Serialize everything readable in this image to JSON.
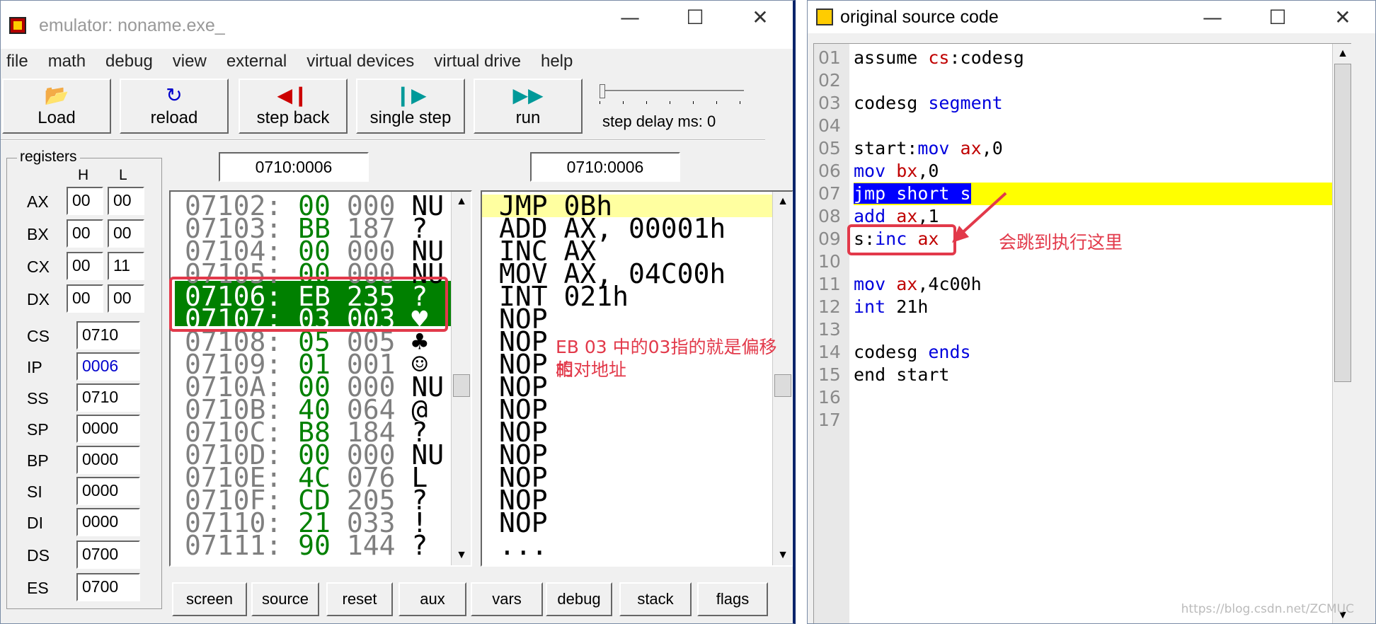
{
  "emulator": {
    "title": "emulator: noname.exe_",
    "menu": [
      "file",
      "math",
      "debug",
      "view",
      "external",
      "virtual devices",
      "virtual drive",
      "help"
    ],
    "toolbar": {
      "load": "Load",
      "reload": "reload",
      "step_back": "step back",
      "single_step": "single step",
      "run": "run",
      "step_delay": "step delay ms: 0"
    },
    "registers": {
      "legend": "registers",
      "h": "H",
      "l": "L",
      "ax": {
        "name": "AX",
        "h": "00",
        "l": "00"
      },
      "bx": {
        "name": "BX",
        "h": "00",
        "l": "00"
      },
      "cx": {
        "name": "CX",
        "h": "00",
        "l": "11"
      },
      "dx": {
        "name": "DX",
        "h": "00",
        "l": "00"
      },
      "cs": {
        "name": "CS",
        "v": "0710"
      },
      "ip": {
        "name": "IP",
        "v": "0006"
      },
      "ss": {
        "name": "SS",
        "v": "0710"
      },
      "sp": {
        "name": "SP",
        "v": "0000"
      },
      "bp": {
        "name": "BP",
        "v": "0000"
      },
      "si": {
        "name": "SI",
        "v": "0000"
      },
      "di": {
        "name": "DI",
        "v": "0000"
      },
      "ds": {
        "name": "DS",
        "v": "0700"
      },
      "es": {
        "name": "ES",
        "v": "0700"
      }
    },
    "mem_addr": "0710:0006",
    "dis_addr": "0710:0006",
    "memory": [
      {
        "a": "07102:",
        "h": "00",
        "d": "000",
        "c": "NU"
      },
      {
        "a": "07103:",
        "h": "BB",
        "d": "187",
        "c": "?"
      },
      {
        "a": "07104:",
        "h": "00",
        "d": "000",
        "c": "NU"
      },
      {
        "a": "07105:",
        "h": "00",
        "d": "000",
        "c": "NU"
      },
      {
        "a": "07106:",
        "h": "EB",
        "d": "235",
        "c": "?"
      },
      {
        "a": "07107:",
        "h": "03",
        "d": "003",
        "c": "♥"
      },
      {
        "a": "07108:",
        "h": "05",
        "d": "005",
        "c": "♣"
      },
      {
        "a": "07109:",
        "h": "01",
        "d": "001",
        "c": "☺"
      },
      {
        "a": "0710A:",
        "h": "00",
        "d": "000",
        "c": "NU"
      },
      {
        "a": "0710B:",
        "h": "40",
        "d": "064",
        "c": "@"
      },
      {
        "a": "0710C:",
        "h": "B8",
        "d": "184",
        "c": "?"
      },
      {
        "a": "0710D:",
        "h": "00",
        "d": "000",
        "c": "NU"
      },
      {
        "a": "0710E:",
        "h": "4C",
        "d": "076",
        "c": "L"
      },
      {
        "a": "0710F:",
        "h": "CD",
        "d": "205",
        "c": "?"
      },
      {
        "a": "07110:",
        "h": "21",
        "d": "033",
        "c": "!"
      },
      {
        "a": "07111:",
        "h": "90",
        "d": "144",
        "c": "?"
      }
    ],
    "disasm": [
      "JMP 0Bh",
      "ADD AX, 00001h",
      "INC AX",
      "MOV AX, 04C00h",
      "INT 021h",
      "NOP",
      "NOP",
      "NOP",
      "NOP",
      "NOP",
      "NOP",
      "NOP",
      "NOP",
      "NOP",
      "NOP",
      "..."
    ],
    "bottom_buttons": [
      "screen",
      "source",
      "reset",
      "aux",
      "vars",
      "debug",
      "stack",
      "flags"
    ],
    "annotation": [
      "EB 03 中的03指的就是偏移的",
      "相对地址"
    ]
  },
  "source": {
    "title": "original source code",
    "lines": [
      {
        "n": "01",
        "t": "assume cs:codesg"
      },
      {
        "n": "02",
        "t": ""
      },
      {
        "n": "03",
        "t": "codesg segment"
      },
      {
        "n": "04",
        "t": ""
      },
      {
        "n": "05",
        "t": "start:mov ax,0"
      },
      {
        "n": "06",
        "t": "mov bx,0"
      },
      {
        "n": "07",
        "t": "jmp short s"
      },
      {
        "n": "08",
        "t": "add ax,1"
      },
      {
        "n": "09",
        "t": "s:inc ax"
      },
      {
        "n": "10",
        "t": ""
      },
      {
        "n": "11",
        "t": "mov ax,4c00h"
      },
      {
        "n": "12",
        "t": "int 21h"
      },
      {
        "n": "13",
        "t": ""
      },
      {
        "n": "14",
        "t": "codesg ends"
      },
      {
        "n": "15",
        "t": "end start"
      },
      {
        "n": "16",
        "t": ""
      },
      {
        "n": "17",
        "t": ""
      }
    ],
    "annotation": "会跳到执行这里",
    "watermark": "https://blog.csdn.net/ZCMUC"
  },
  "colors": {
    "accent_green": "#008000",
    "highlight_yellow": "#ffff00",
    "annotation_red": "#e2394a",
    "selection_blue": "#0000ff"
  }
}
